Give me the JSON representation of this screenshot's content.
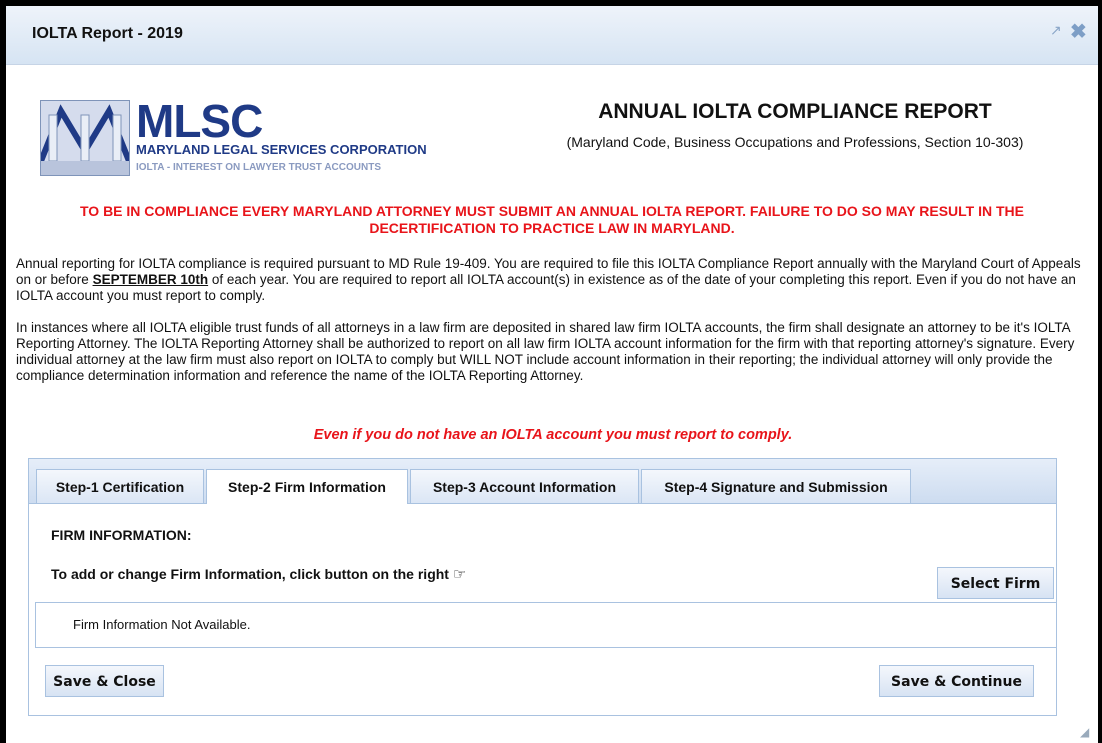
{
  "window": {
    "title": "IOLTA Report - 2019"
  },
  "logo": {
    "name": "MLSC",
    "line1": "MARYLAND LEGAL SERVICES CORPORATION",
    "line2": "IOLTA - INTEREST ON LAWYER TRUST ACCOUNTS"
  },
  "header": {
    "title": "ANNUAL IOLTA COMPLIANCE REPORT",
    "subtitle": "(Maryland Code, Business Occupations and Professions, Section 10-303)"
  },
  "warning": "TO BE IN COMPLIANCE EVERY MARYLAND ATTORNEY MUST SUBMIT AN ANNUAL IOLTA REPORT. FAILURE TO DO SO MAY RESULT IN THE DECERTIFICATION TO PRACTICE LAW IN MARYLAND.",
  "paragraph1": {
    "before": "Annual reporting for IOLTA compliance is required pursuant to MD Rule 19-409. You are required to file this IOLTA Compliance Report annually with the Maryland Court of Appeals on or before ",
    "deadline": "SEPTEMBER 10th",
    "after": " of each year. You are required to report all IOLTA account(s) in existence as of the date of your completing this report. Even if you do not have an IOLTA account you must report to comply."
  },
  "paragraph2": "In instances where all IOLTA eligible trust funds of all attorneys in a law firm are deposited in shared law firm IOLTA accounts, the firm shall designate an attorney to be it's IOLTA Reporting Attorney. The IOLTA Reporting Attorney shall be authorized to report on all law firm IOLTA account information for the firm with that reporting attorney's signature. Every individual attorney at the law firm must also report on IOLTA to comply but WILL NOT include account information in their reporting; the individual attorney will only provide the compliance determination information and reference the name of the IOLTA Reporting Attorney.",
  "reminder": "Even if you do not have an IOLTA account you must report to comply.",
  "tabs": [
    {
      "label": "Step-1 Certification"
    },
    {
      "label": "Step-2 Firm Information"
    },
    {
      "label": "Step-3 Account Information"
    },
    {
      "label": "Step-4 Signature and Submission"
    }
  ],
  "active_tab": "Step-2 Firm Information",
  "firm": {
    "section_label": "FIRM INFORMATION:",
    "instruction": "To add or change Firm Information, click button on the right",
    "select_button": "Select Firm",
    "status": "Firm Information Not Available."
  },
  "actions": {
    "save_close": "Save & Close",
    "save_continue": "Save & Continue"
  },
  "icons": [
    "popout-icon",
    "close-icon",
    "pointing-hand-icon",
    "resize-grip-icon"
  ]
}
